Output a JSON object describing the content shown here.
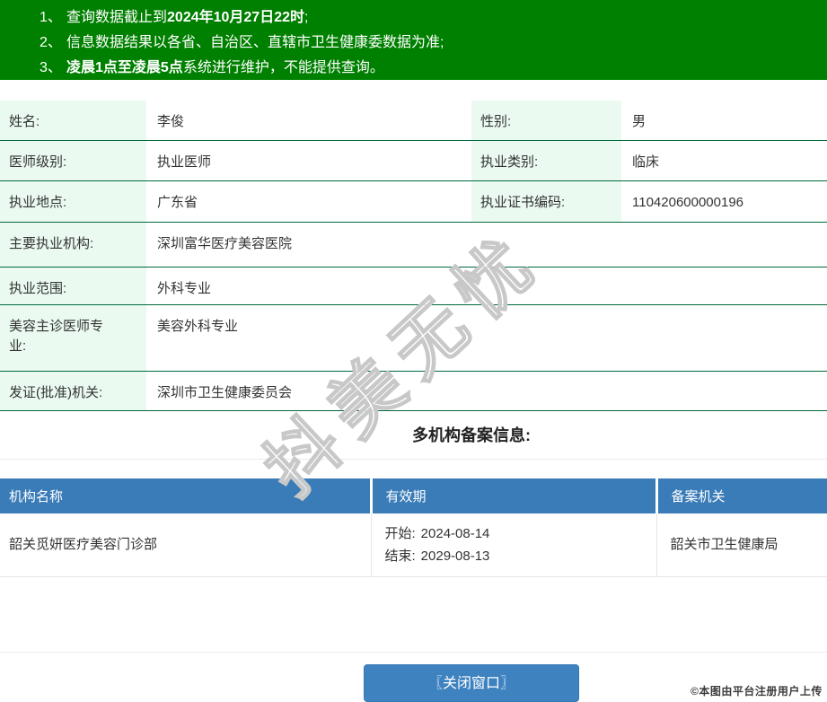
{
  "notices": {
    "items": [
      {
        "num": "1、",
        "pre": "查询数据截止到",
        "bold": "2024年10月27日22时",
        "post": ";"
      },
      {
        "num": "2、",
        "pre": "信息数据结果以各省、自治区、直辖市卫生健康委数据为准;",
        "bold": "",
        "post": ""
      },
      {
        "num": "3、",
        "pre": "",
        "bold": "凌晨1点至凌晨5点",
        "post": "系统进行维护，不能提供查询。"
      }
    ]
  },
  "doctor": {
    "fields": {
      "name_label": "姓名:",
      "name": "李俊",
      "gender_label": "性别:",
      "gender": "男",
      "level_label": "医师级别:",
      "level": "执业医师",
      "category_label": "执业类别:",
      "category": "临床",
      "location_label": "执业地点:",
      "location": "广东省",
      "cert_no_label": "执业证书编码:",
      "cert_no": "110420600000196",
      "main_org_label": "主要执业机构:",
      "main_org": "深圳富华医疗美容医院",
      "scope_label": "执业范围:",
      "scope": "外科专业",
      "cosmetic_label": "美容主诊医师专业:",
      "cosmetic": "美容外科专业",
      "issuer_label": "发证(批准)机关:",
      "issuer": "深圳市卫生健康委员会"
    }
  },
  "records_section": {
    "title": "多机构备案信息:",
    "columns": {
      "org": "机构名称",
      "validity": "有效期",
      "authority": "备案机关"
    },
    "rows": [
      {
        "org": "韶关觅妍医疗美容门诊部",
        "start_label": "开始:",
        "start": "2024-08-14",
        "end_label": "结束:",
        "end": "2029-08-13",
        "authority": "韶关市卫生健康局"
      }
    ]
  },
  "footer": {
    "close_button": "〖关闭窗口〗",
    "copyright": "©本图由平台注册用户上传"
  },
  "watermark": "抖美无忧",
  "colors": {
    "banner_green": "#008000",
    "label_mint": "#eafaf1",
    "row_border_green": "#00693c",
    "table_header_blue": "#3a7cb8",
    "button_blue": "#3e82c0"
  }
}
